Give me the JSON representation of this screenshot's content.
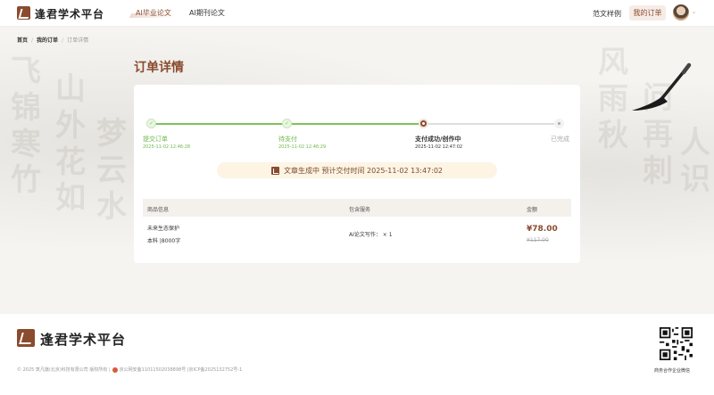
{
  "header": {
    "logo_text": "逢君学术平台",
    "nav": [
      "AI毕业论文",
      "AI期刊论文"
    ],
    "links": {
      "samples": "范文样例",
      "my_orders": "我的订单"
    },
    "avatar_caret": "⌄"
  },
  "breadcrumb": {
    "home": "首页",
    "orders": "我的订单",
    "current": "订单详情",
    "sep": "/"
  },
  "page_title": "订单详情",
  "steps": [
    {
      "label": "提交订单",
      "time": "2025-11-02 12:46:28",
      "state": "done"
    },
    {
      "label": "待支付",
      "time": "2025-11-02 12:46:29",
      "state": "done"
    },
    {
      "label": "支付成功/创作中",
      "time": "2025-11-02 12:47:02",
      "state": "current"
    },
    {
      "label": "已完成",
      "time": "",
      "state": "pending"
    }
  ],
  "banner": {
    "text": "文章生成中 预计交付时间 2025-11-02 13:47:02"
  },
  "table": {
    "headers": [
      "商品信息",
      "包含服务",
      "金额"
    ],
    "row": {
      "title": "未来生态保护",
      "spec": "本科 |8000字",
      "service": "AI论文写作：  × 1",
      "price": "¥78.00",
      "old_price": "¥117.00"
    }
  },
  "footer": {
    "logo_text": "逢君学术平台",
    "copyright": "© 2025 筑凡旗(北京)科技有限公司 版权所有 |",
    "police": "京公网安备11011502038898号",
    "icp": "|京ICP备2025132752号-1",
    "qr_caption": "商务合作企业微信"
  },
  "colors": {
    "accent": "#8a4b2e",
    "success": "#6db94b",
    "banner_bg": "#fdf4e4"
  }
}
